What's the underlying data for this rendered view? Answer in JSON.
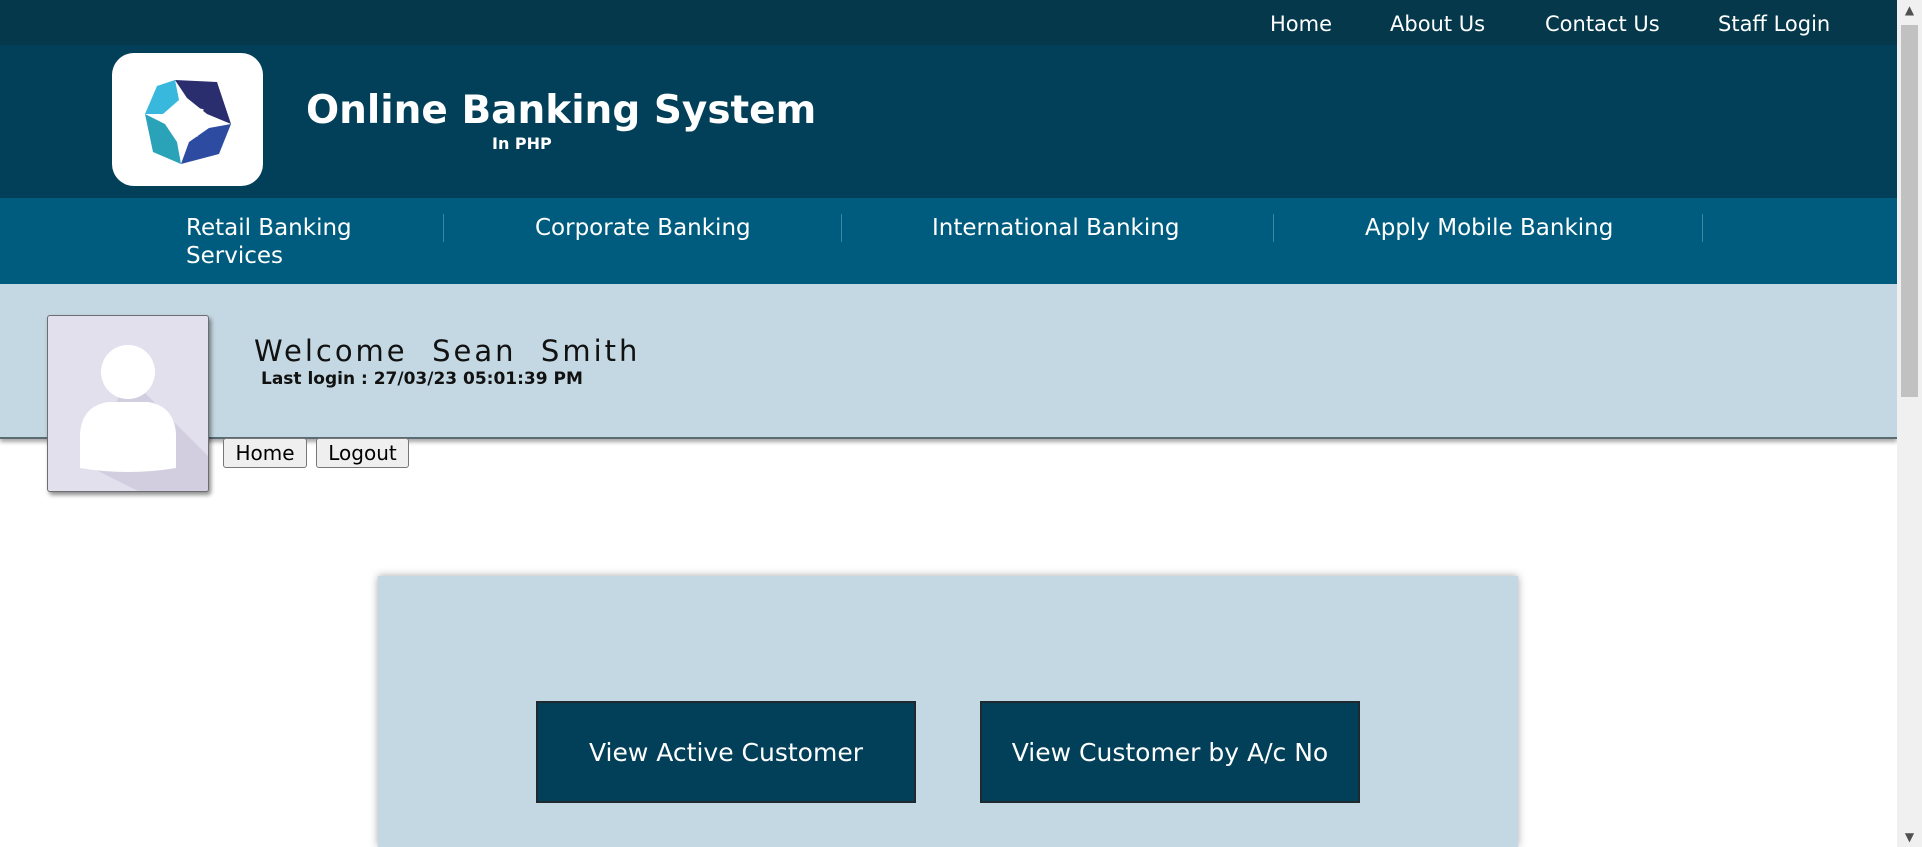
{
  "top_nav": [
    "Home",
    "About Us",
    "Contact Us",
    "Staff Login"
  ],
  "header": {
    "title": "Online Banking System",
    "subtitle": "In PHP"
  },
  "main_nav": [
    "Retail Banking Services",
    "Corporate Banking",
    "International Banking",
    "Apply Mobile Banking"
  ],
  "user": {
    "welcome": "Welcome  Sean  Smith",
    "last_login": "Last login : 27/03/23 05:01:39 PM"
  },
  "user_buttons": {
    "home": "Home",
    "logout": "Logout"
  },
  "panel": {
    "buttons": [
      "View Active Customer",
      "View Customer by A/c No"
    ]
  },
  "colors": {
    "topbar": "#04384a",
    "header": "#02405a",
    "nav": "#005c7e",
    "band": "#c3d8e2",
    "button": "#02405a"
  }
}
